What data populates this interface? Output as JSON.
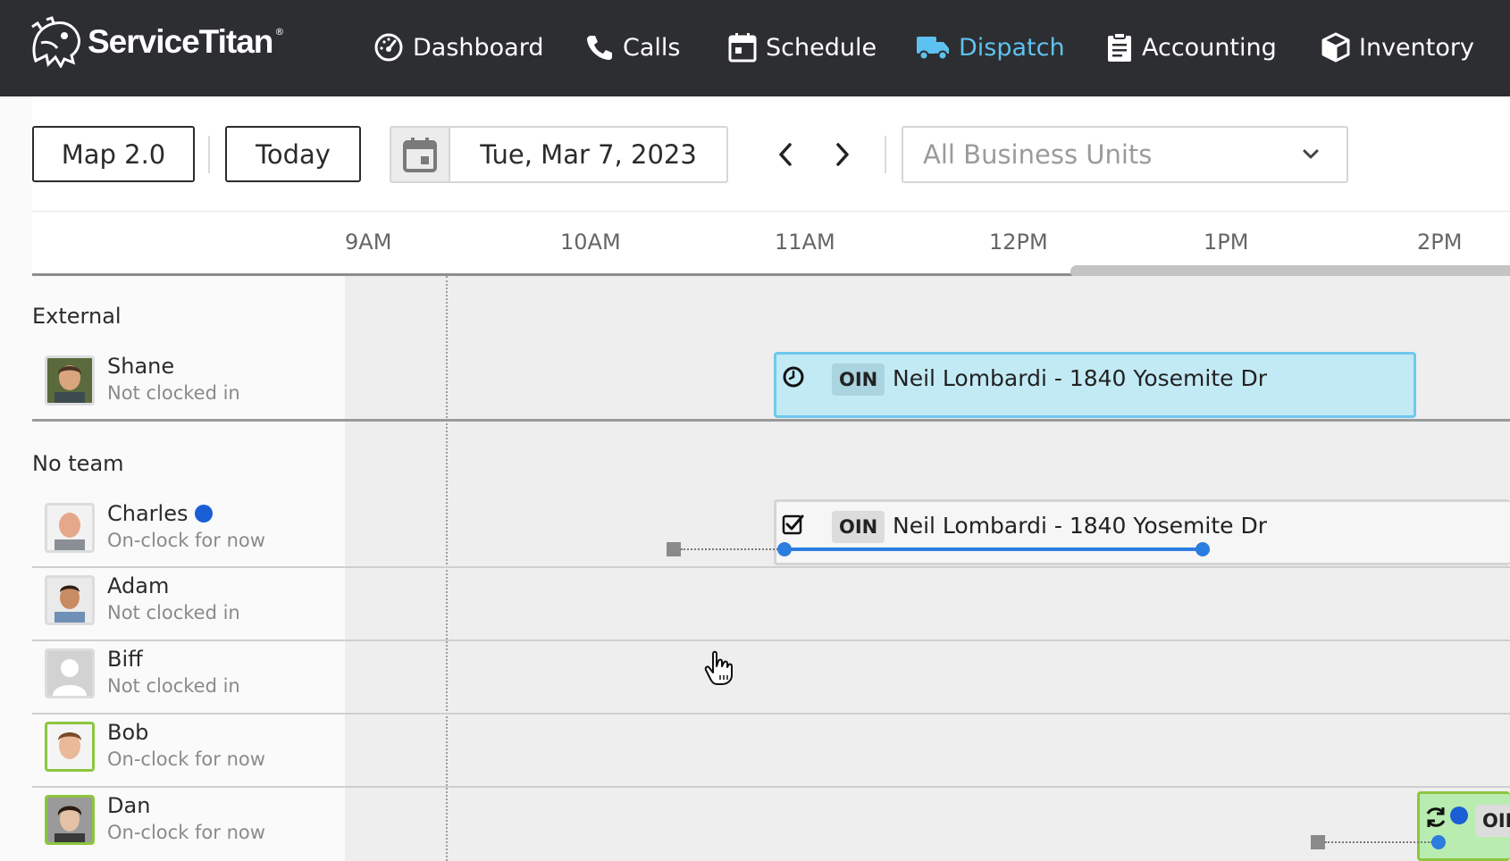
{
  "brand": {
    "name": "ServiceTitan",
    "reg": "®"
  },
  "nav": [
    {
      "label": "Dashboard",
      "icon": "speedometer-icon"
    },
    {
      "label": "Calls",
      "icon": "phone-icon"
    },
    {
      "label": "Schedule",
      "icon": "calendar-icon"
    },
    {
      "label": "Dispatch",
      "icon": "truck-icon",
      "active": true
    },
    {
      "label": "Accounting",
      "icon": "clipboard-icon"
    },
    {
      "label": "Inventory",
      "icon": "box-icon"
    }
  ],
  "toolbar": {
    "map_label": "Map 2.0",
    "today_label": "Today",
    "date": "Tue, Mar 7, 2023",
    "business_units_placeholder": "All Business Units"
  },
  "timeline": {
    "ticks": [
      "9AM",
      "10AM",
      "11AM",
      "12PM",
      "1PM",
      "2PM"
    ]
  },
  "groups": [
    {
      "label": "External",
      "technicians": [
        {
          "name": "Shane",
          "status": "Not clocked in"
        }
      ]
    },
    {
      "label": "No team",
      "technicians": [
        {
          "name": "Charles",
          "status": "On-clock for now"
        },
        {
          "name": "Adam",
          "status": "Not clocked in"
        },
        {
          "name": "Biff",
          "status": "Not clocked in"
        },
        {
          "name": "Bob",
          "status": "On-clock for now"
        },
        {
          "name": "Dan",
          "status": "On-clock for now"
        }
      ]
    }
  ],
  "jobs": [
    {
      "badge": "OIN",
      "title": "Neil Lombardi - 1840 Yosemite Dr"
    },
    {
      "badge": "OIN",
      "title": "Neil Lombardi - 1840 Yosemite Dr"
    },
    {
      "badge": "OIN"
    }
  ],
  "colors": {
    "nav_bg": "#2d2e31",
    "active_nav": "#5ec2f0",
    "job_scheduled": "#c2eaf5",
    "job_working": "#b9ecb0",
    "on_clock_border": "#8cc63f",
    "travel_blue": "#2b7de0"
  }
}
